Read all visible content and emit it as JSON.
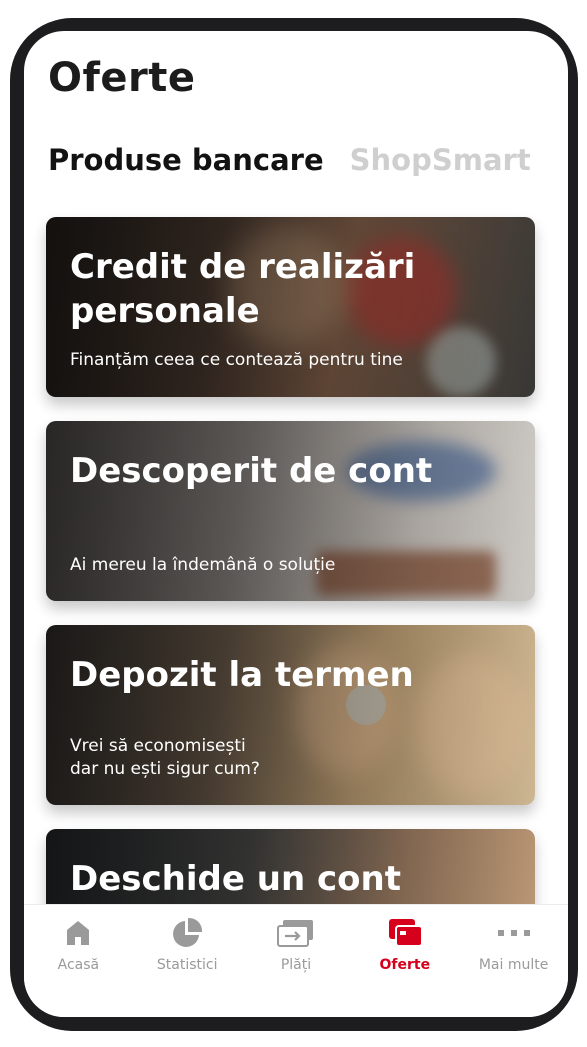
{
  "page": {
    "title": "Oferte"
  },
  "tabs": [
    {
      "label": "Produse bancare",
      "active": true
    },
    {
      "label": "ShopSmart",
      "active": false
    }
  ],
  "cards": [
    {
      "title": "Credit de realizări personale",
      "subtitle": "Finanțăm ceea ce contează pentru tine"
    },
    {
      "title": "Descoperit de cont",
      "subtitle": "Ai mereu la îndemână o soluție"
    },
    {
      "title": "Depozit la termen",
      "subtitle": "Vrei să economisești\ndar nu ești sigur cum?"
    },
    {
      "title": "Deschide un cont",
      "subtitle": ""
    }
  ],
  "nav": [
    {
      "label": "Acasă",
      "icon": "home-icon",
      "active": false
    },
    {
      "label": "Statistici",
      "icon": "pie-chart-icon",
      "active": false
    },
    {
      "label": "Plăți",
      "icon": "transfer-icon",
      "active": false
    },
    {
      "label": "Oferte",
      "icon": "cards-icon",
      "active": true
    },
    {
      "label": "Mai multe",
      "icon": "more-icon",
      "active": false
    }
  ],
  "colors": {
    "accent": "#d6001c",
    "inactive": "#9a9a9a",
    "tab_inactive": "#cfcfcf"
  }
}
